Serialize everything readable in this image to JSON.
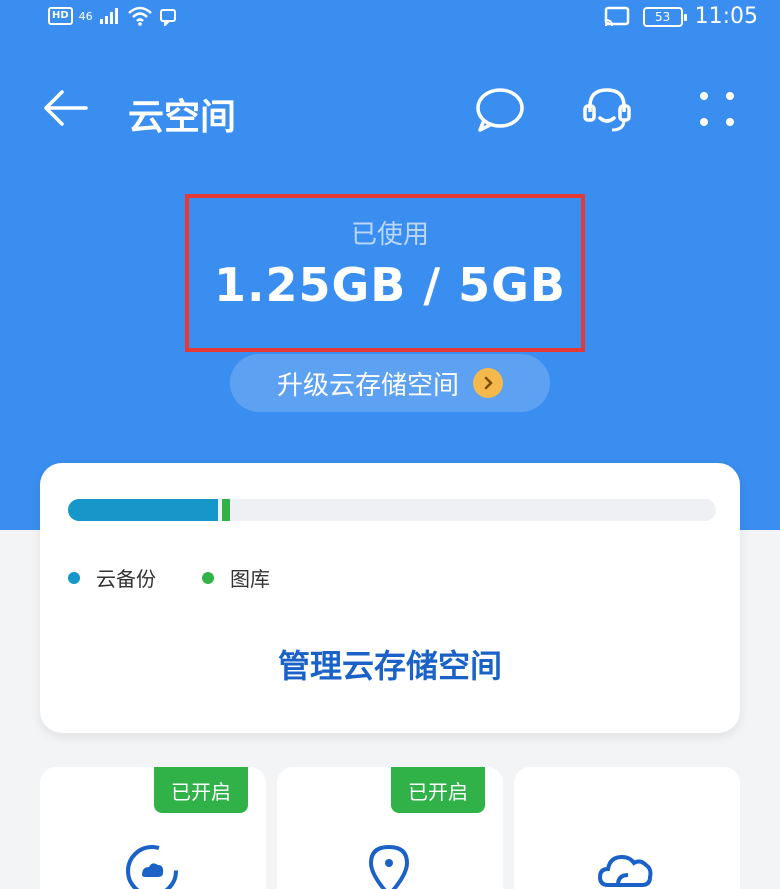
{
  "status_bar": {
    "hd": "HD",
    "network": "46",
    "time": "11:05",
    "battery": "53"
  },
  "header": {
    "title": "云空间"
  },
  "usage": {
    "label": "已使用",
    "value": "1.25GB / 5GB",
    "used_fraction": 0.25
  },
  "upgrade": {
    "label": "升级云存储空间"
  },
  "storage_card": {
    "legend": [
      {
        "label": "云备份",
        "color": "#1696c9"
      },
      {
        "label": "图库",
        "color": "#30b249"
      }
    ],
    "gallery_fraction": 0.012,
    "manage_label": "管理云存储空间"
  },
  "tiles": [
    {
      "badge": "已开启",
      "icon": "cloud-backup-icon"
    },
    {
      "badge": "已开启",
      "icon": "location-pin-icon"
    },
    {
      "badge": "",
      "icon": "cloud-icon"
    }
  ],
  "colors": {
    "primary": "#3a8ef0",
    "accent": "#1a62c7",
    "alert_box": "#e53935",
    "badge": "#30b249"
  }
}
